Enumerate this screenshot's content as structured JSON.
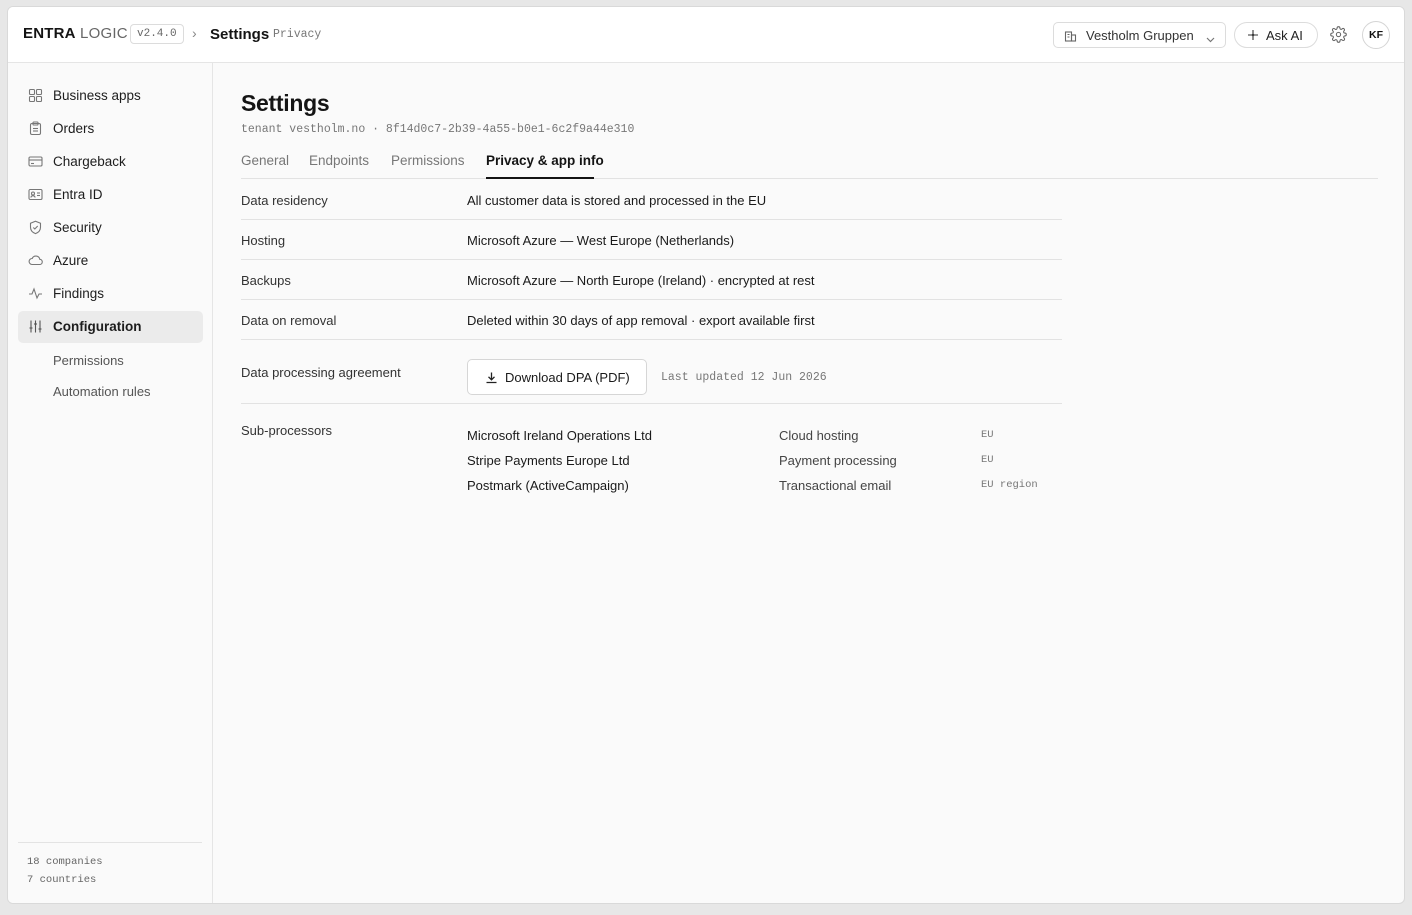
{
  "header": {
    "brand_primary": "ENTRA",
    "brand_secondary": "LOGIC",
    "version": "v2.4.0",
    "breadcrumb_separator": "›",
    "breadcrumb_title": "Settings",
    "breadcrumb_sub": "Privacy",
    "org_selector": "Vestholm Gruppen",
    "ask_ai": "Ask AI",
    "avatar_initials": "KF"
  },
  "sidebar": {
    "items": [
      {
        "label": "Business apps",
        "icon": "grid-icon"
      },
      {
        "label": "Orders",
        "icon": "clipboard-icon"
      },
      {
        "label": "Chargeback",
        "icon": "credit-card-icon"
      },
      {
        "label": "Entra ID",
        "icon": "id-card-icon"
      },
      {
        "label": "Security",
        "icon": "shield-icon"
      },
      {
        "label": "Azure",
        "icon": "cloud-icon"
      },
      {
        "label": "Findings",
        "icon": "activity-icon"
      },
      {
        "label": "Configuration",
        "icon": "sliders-icon",
        "active": true
      }
    ],
    "sub_items": [
      "Permissions",
      "Automation rules"
    ],
    "footer": {
      "companies": "18 companies",
      "countries": "7 countries"
    }
  },
  "main": {
    "title": "Settings",
    "tenant": "tenant vestholm.no · 8f14d0c7-2b39-4a55-b0e1-6c2f9a44e310",
    "tabs": [
      "General",
      "Endpoints",
      "Permissions",
      "Privacy & app info"
    ],
    "active_tab": "Privacy & app info",
    "rows": [
      {
        "key": "Data residency",
        "value": "All customer data is stored and processed in the EU"
      },
      {
        "key": "Hosting",
        "value": "Microsoft Azure — West Europe (Netherlands)"
      },
      {
        "key": "Backups",
        "value": "Microsoft Azure — North Europe (Ireland) · encrypted at rest"
      },
      {
        "key": "Data on removal",
        "value": "Deleted within 30 days of app removal · export available first"
      }
    ],
    "dpa": {
      "key": "Data processing agreement",
      "button": "Download DPA (PDF)",
      "last_updated": "Last updated 12 Jun 2026"
    },
    "subprocessors": {
      "label": "Sub-processors",
      "items": [
        {
          "name": "Microsoft Ireland Operations Ltd",
          "purpose": "Cloud hosting",
          "region": "EU"
        },
        {
          "name": "Stripe Payments Europe Ltd",
          "purpose": "Payment processing",
          "region": "EU"
        },
        {
          "name": "Postmark (ActiveCampaign)",
          "purpose": "Transactional email",
          "region": "EU region"
        }
      ]
    }
  }
}
